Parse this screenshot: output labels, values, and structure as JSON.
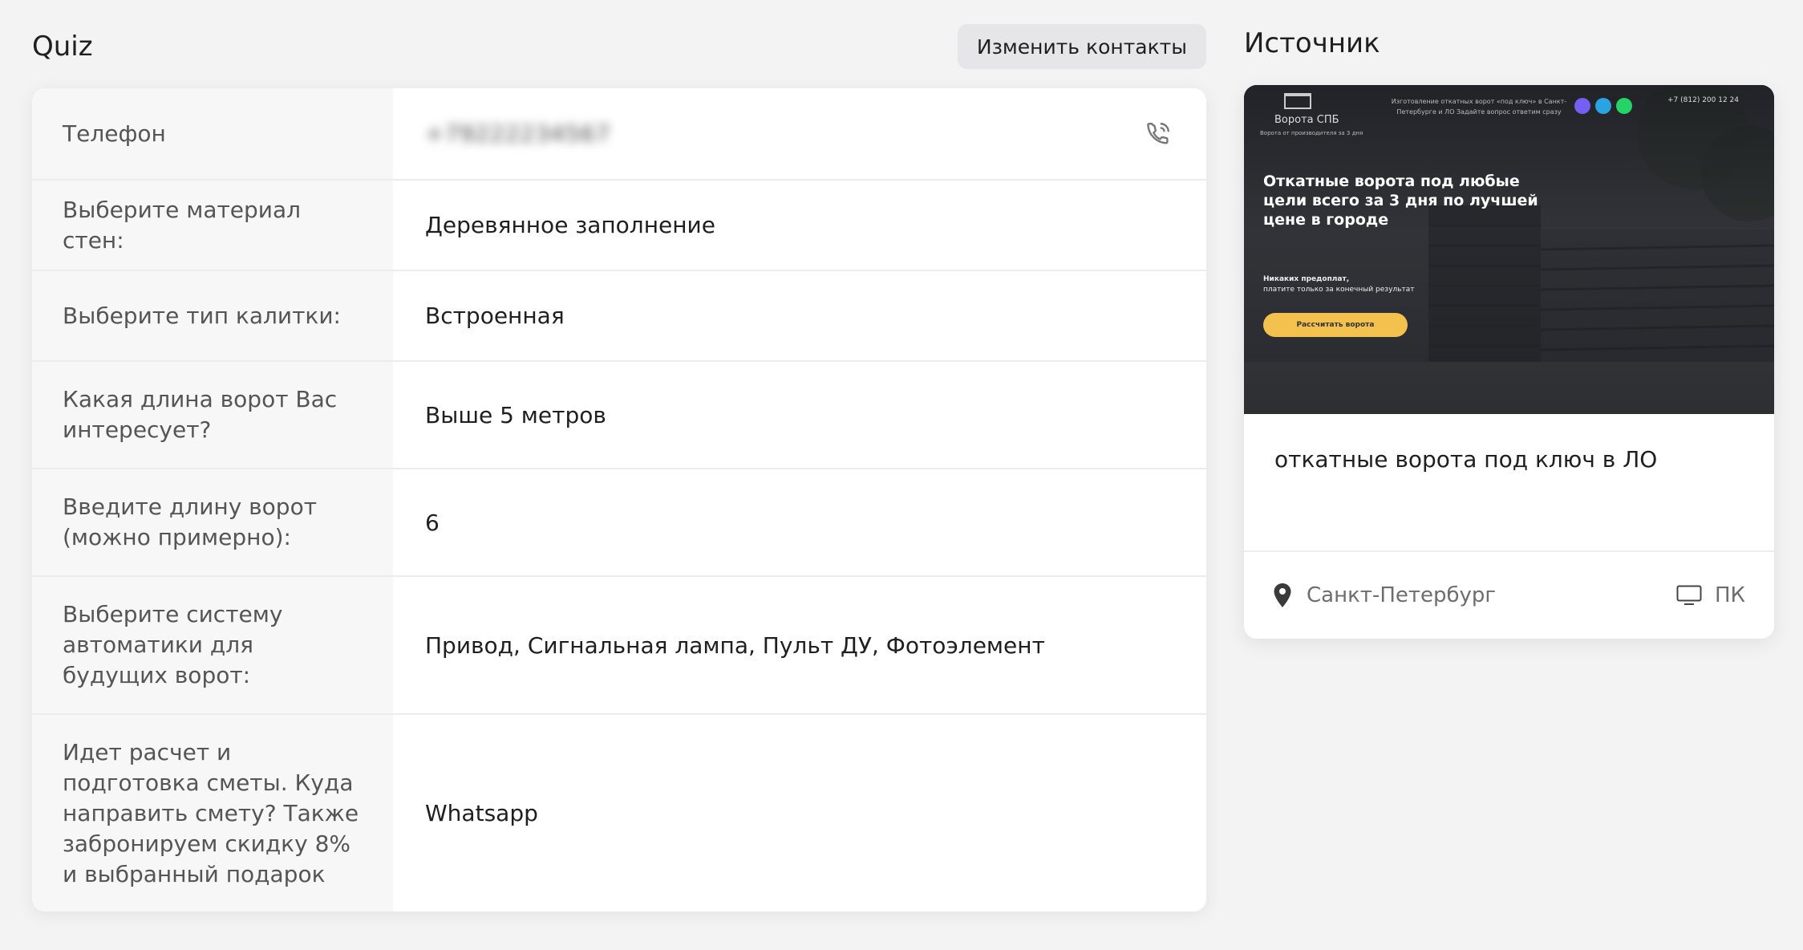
{
  "quiz": {
    "title": "Quiz",
    "edit_button": "Изменить контакты",
    "rows": [
      {
        "label": "Телефон",
        "value": "+79222234567"
      },
      {
        "label": "Выберите материал стен:",
        "value": "Деревянное заполнение"
      },
      {
        "label": "Выберите тип калитки:",
        "value": "Встроенная"
      },
      {
        "label": "Какая длина ворот Вас интересует?",
        "value": "Выше 5 метров"
      },
      {
        "label": "Введите длину ворот (можно примерно):",
        "value": "6"
      },
      {
        "label": "Выберите систему автоматики для будущих ворот:",
        "value": "Привод, Сигнальная лампа, Пульт ДУ, Фотоэлемент"
      },
      {
        "label": "Идет расчет и подготовка сметы. Куда направить смету? Также забронируем скидку 8% и выбранный подарок",
        "value": "Whatsapp"
      }
    ]
  },
  "source": {
    "title": "Источник",
    "preview": {
      "brand": "Ворота СПБ",
      "brand_sub": "Ворота от производителя за 3 дня",
      "topline": "Изготовление откатных ворот «под ключ» в Санкт-Петербурге и ЛО Задайте вопрос ответим сразу",
      "phone": "+7 (812) 200 12 24",
      "headline": "Откатные ворота под любые цели всего за 3 дня по лучшей цене в городе",
      "note_bold": "Никаких предоплат,",
      "note": "платите только за конечный результат",
      "cta": "Рассчитать ворота",
      "messenger_colors": [
        "#7360f2",
        "#2aa3e0",
        "#25d366"
      ],
      "cta_color": "#f2c14e"
    },
    "campaign": "откатные ворота под ключ в ЛО",
    "location": "Санкт-Петербург",
    "device": "ПК"
  }
}
